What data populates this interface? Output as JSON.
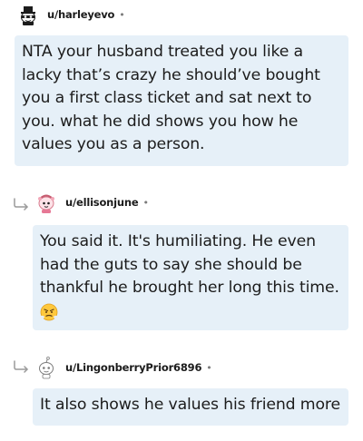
{
  "comments": [
    {
      "username": "u/harleyevo",
      "separator": "•",
      "avatar_icon": "snoo-tophat-avatar",
      "text": "NTA your husband treated you like a lacky that’s crazy he should’ve bought you a first class ticket and sat next to you. what he did shows you how he values you as a person.",
      "is_reply": false
    },
    {
      "username": "u/ellisonjune",
      "separator": "•",
      "avatar_icon": "snoo-pink-avatar",
      "text": "You said it. It's humiliating. He even had the guts to say she should be thankful he brought her long this time.",
      "emoji_icon": "angry-steam-face-emoji",
      "is_reply": true
    },
    {
      "username": "u/LingonberryPrior6896",
      "separator": "•",
      "avatar_icon": "snoo-default-avatar",
      "text": "It also shows he values his friend more",
      "is_reply": true
    }
  ],
  "colors": {
    "bubble_bg": "#e6f0f8",
    "text": "#1c1c1c",
    "meta": "#7c7c7c"
  }
}
